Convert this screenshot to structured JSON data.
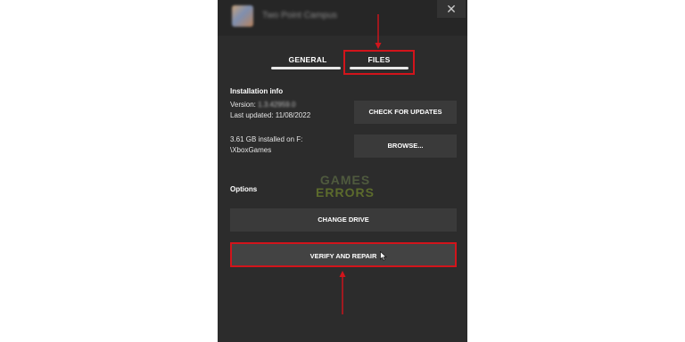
{
  "title_bar": {
    "app_title": "Two Point Campus",
    "close_glyph": "✕"
  },
  "tabs": [
    {
      "label": "GENERAL",
      "active": false
    },
    {
      "label": "FILES",
      "active": true
    }
  ],
  "installation": {
    "heading": "Installation info",
    "version_label": "Version:",
    "version_value": "1.3.42959.0",
    "last_updated": "Last updated: 11/08/2022",
    "install_size_line1": "3.61 GB installed on F:",
    "install_size_line2": "\\XboxGames"
  },
  "buttons": {
    "check_updates": "CHECK FOR UPDATES",
    "browse": "BROWSE...",
    "change_drive": "CHANGE DRIVE",
    "verify_repair": "VERIFY AND REPAIR"
  },
  "options": {
    "heading": "Options"
  },
  "watermark": {
    "line1": "GAMES",
    "line2": "ERRORS"
  },
  "colors": {
    "panel_bg": "#2c2c2c",
    "button_bg": "#3a3a3a",
    "highlight_red": "#d2141b"
  },
  "icons": {
    "app": "app-icon",
    "close": "close-icon",
    "cursor": "mouse-cursor-icon"
  }
}
